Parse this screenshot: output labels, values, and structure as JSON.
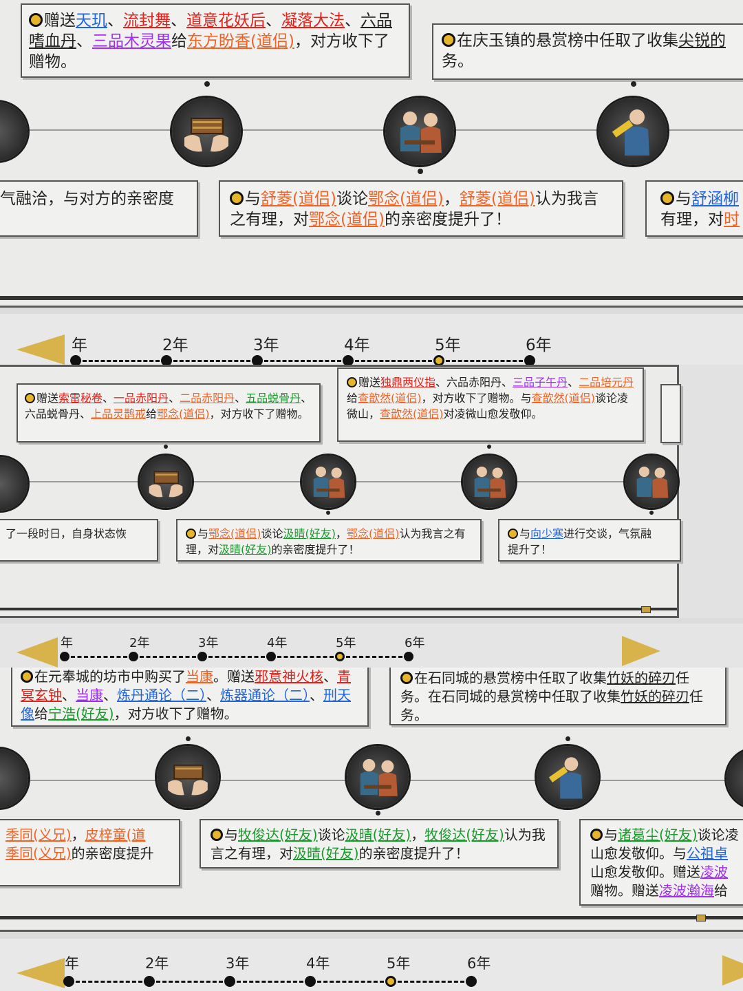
{
  "colors": {
    "red": "#e2221b",
    "orange": "#f06428",
    "purple": "#a12ef0",
    "blue": "#2266dd",
    "green": "#189a2a",
    "gold": "#e7b52a"
  },
  "icons": {
    "gift": "gift-box-icon",
    "talk": "conversation-icon",
    "bounty": "bounty-scroll-icon",
    "person": "cultivator-icon"
  },
  "s1": {
    "c1": [
      "赠送",
      "天玑",
      "、",
      "流封舞",
      "、",
      "道意花妖后",
      "、",
      "凝落大法",
      "、",
      "六品嗜血丹",
      "、",
      "三品木灵果",
      "给",
      "东方盼香(道侣)",
      "，对方收下了赠物。"
    ],
    "c2": [
      "在庆玉镇的悬赏榜中任取了收集",
      "尖锐的",
      "务。"
    ],
    "c3": [
      "气融洽，与对方的亲密度"
    ],
    "c4": [
      "与",
      "舒菱(道侣)",
      "谈论",
      "鄂念(道侣)",
      "，",
      "舒菱(道侣)",
      "认为我言之有理，对",
      "鄂念(道侣)",
      "的亲密度提升了！"
    ],
    "c5": [
      "与",
      "舒涵柳",
      "有理，对",
      "时"
    ]
  },
  "years1": {
    "labels": [
      "年",
      "2年",
      "3年",
      "4年",
      "5年",
      "6年"
    ],
    "current": 5
  },
  "s2": {
    "c1": [
      "赠送",
      "索雷秘卷",
      "、",
      "一品赤阳丹",
      "、",
      "二品赤阳丹",
      "、",
      "五品蜕骨丹",
      "、六品蜕骨丹、",
      "上品灵鹊戒",
      "给",
      "鄂念(道侣)",
      "，对方收下了赠物。"
    ],
    "c2": [
      "赠送",
      "独鼎两仪指",
      "、六品赤阳丹、",
      "三品子午丹",
      "、",
      "二品培元丹",
      "给",
      "查歆然(道侣)",
      "，对方收下了赠物。与",
      "查歆然(道侣)",
      "谈论凌微山，",
      "查歆然(道侣)",
      "对凌微山愈发敬仰。"
    ],
    "c3": [
      "了一段时日，自身状态恢"
    ],
    "c4": [
      "与",
      "鄂念(道侣)",
      "谈论",
      "汲晴(好友)",
      "，",
      "鄂念(道侣)",
      "认为我言之有理，对",
      "汲晴(好友)",
      "的亲密度提升了！"
    ],
    "c5": [
      "与",
      "向少寒",
      "进行交谈，气氛融",
      "提升了！"
    ]
  },
  "years2": {
    "labels": [
      "年",
      "2年",
      "3年",
      "4年",
      "5年",
      "6年"
    ],
    "current": 5
  },
  "s3": {
    "c1": [
      "在元奉城的坊市中购买了",
      "当康",
      "。赠送",
      "邪意神火核",
      "、",
      "青冥玄钟",
      "、",
      "当康",
      "、",
      "炼丹通论（二）",
      "、",
      "炼器通论（二）",
      "、",
      "刑天像",
      "给",
      "宁浩(好友)",
      "，对方收下了赠物。"
    ],
    "c2": [
      "在石同城的悬赏榜中任取了收集",
      "竹妖的碎刃",
      "任务。在石同城的悬赏榜中任取了收集",
      "竹妖的碎刃",
      "任务。"
    ],
    "c3": [
      "季同(义兄)",
      "，",
      "皮梓童(道",
      "季同(义兄)",
      "的亲密度提升"
    ],
    "c4": [
      "与",
      "牧俊达(好友)",
      "谈论",
      "汲晴(好友)",
      "，",
      "牧俊达(好友)",
      "认为我言之有理，对",
      "汲晴(好友)",
      "的亲密度提升了！"
    ],
    "c5": [
      "与",
      "诸葛尘(好友)",
      "谈论凌",
      "山愈发敬仰。与",
      "公祖卓",
      "山愈发敬仰。赠送",
      "凌波",
      "赠物。赠送",
      "凌波瀚海",
      "给"
    ]
  },
  "years3": {
    "labels": [
      "年",
      "2年",
      "3年",
      "4年",
      "5年",
      "6年"
    ],
    "current": 5
  }
}
